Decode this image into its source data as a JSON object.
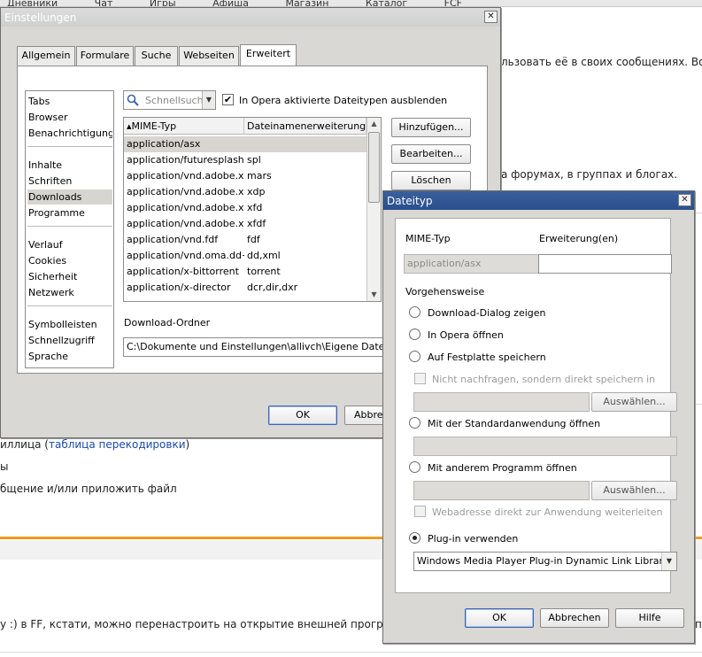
{
  "background": {
    "topnav": [
      "Дневники",
      "Чат",
      "Игры",
      "Афиша",
      "Магазин",
      "Каталог",
      "FCF"
    ],
    "line1": "льзовать её в своих сообщениях. Возм",
    "line2": "а форумах, в группах и блогах.",
    "line3_prefix": "иллица (",
    "line3_link": "таблица перекодировки",
    "line3_suffix": ")",
    "line4": "ы",
    "line5": "бщение и/или приложить файл",
    "line6": "y :) в FF, кстати, можно перенастроить на открытие внешней программо",
    "line6_end": "п"
  },
  "settings": {
    "title": "Einstellungen",
    "close_glyph": "✕",
    "tabs": [
      "Allgemein",
      "Formulare",
      "Suche",
      "Webseiten",
      "Erweitert"
    ],
    "categories_group1": [
      "Tabs",
      "Browser",
      "Benachrichtigungen"
    ],
    "categories_group2": [
      "Inhalte",
      "Schriften",
      "Downloads",
      "Programme"
    ],
    "categories_group3": [
      "Verlauf",
      "Cookies",
      "Sicherheit",
      "Netzwerk"
    ],
    "categories_group4": [
      "Symbolleisten",
      "Schnellzugriff",
      "Sprache"
    ],
    "quicksearch_placeholder": "Schnellsuche",
    "hide_opera_types_label": "In Opera aktivierte Dateitypen ausblenden",
    "hide_opera_types_checked": true,
    "table_headers": [
      "▴MIME-Typ",
      "Dateinamenerweiterung(…"
    ],
    "table_rows": [
      {
        "mime": "application/asx",
        "ext": ""
      },
      {
        "mime": "application/futuresplash",
        "ext": "spl"
      },
      {
        "mime": "application/vnd.adobe.x-…",
        "ext": "mars"
      },
      {
        "mime": "application/vnd.adobe.xd…",
        "ext": "xdp"
      },
      {
        "mime": "application/vnd.adobe.xf…",
        "ext": "xfd"
      },
      {
        "mime": "application/vnd.adobe.xfdf",
        "ext": "xfdf"
      },
      {
        "mime": "application/vnd.fdf",
        "ext": "fdf"
      },
      {
        "mime": "application/vnd.oma.dd+…",
        "ext": "dd,xml"
      },
      {
        "mime": "application/x-bittorrent",
        "ext": "torrent"
      },
      {
        "mime": "application/x-director",
        "ext": "dcr,dir,dxr"
      }
    ],
    "buttons": {
      "add": "Hinzufügen...",
      "edit": "Bearbeiten...",
      "delete": "Löschen"
    },
    "download_folder_label": "Download-Ordner",
    "download_folder_value": "C:\\Dokumente und Einstellungen\\allivch\\Eigene Dateien\\",
    "ok": "OK",
    "cancel": "Abbred"
  },
  "dateityp": {
    "title": "Dateityp",
    "close_glyph": "✕",
    "mime_label": "MIME-Typ",
    "ext_label": "Erweiterung(en)",
    "mime_value": "application/asx",
    "ext_value": "",
    "procedure_label": "Vorgehensweise",
    "options": [
      "Download-Dialog zeigen",
      "In Opera öffnen",
      "Auf Festplatte speichern",
      "Mit der Standardanwendung öffnen",
      "Mit anderem Programm öffnen",
      "Plug-in verwenden"
    ],
    "selected_option": "Plug-in verwenden",
    "no_ask_label": "Nicht nachfragen, sondern direkt speichern in",
    "browse1": "Auswählen...",
    "browse2": "Auswählen...",
    "pass_url_label": "Webadresse direkt zur Anwendung weiterleiten",
    "plugin_value": "Windows Media Player Plug-in Dynamic Link Library",
    "ok": "OK",
    "cancel": "Abbrechen",
    "help": "Hilfe"
  }
}
